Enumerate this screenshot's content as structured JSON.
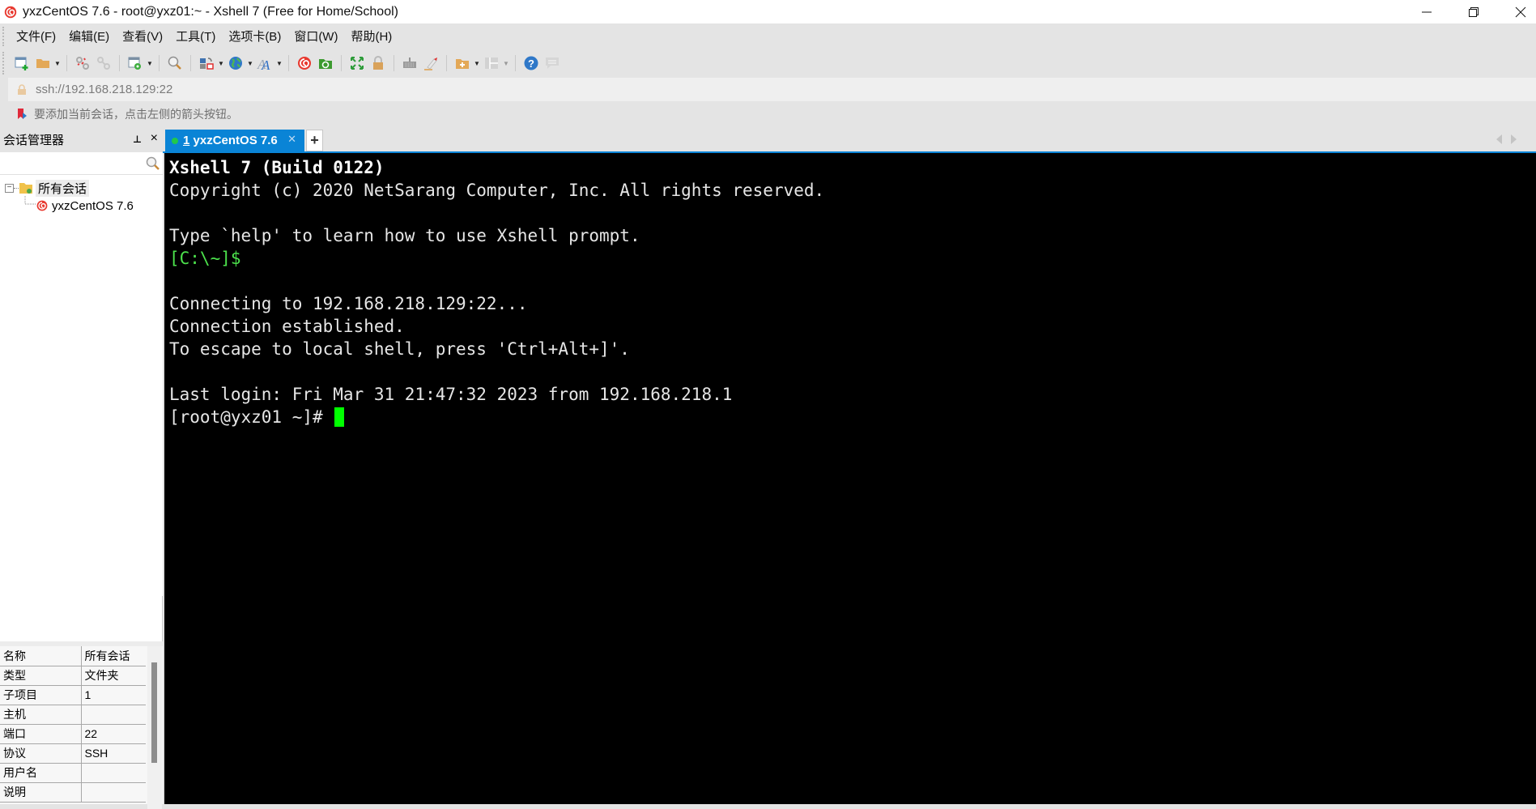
{
  "window": {
    "title": "yxzCentOS 7.6 - root@yxz01:~ - Xshell 7 (Free for Home/School)",
    "controls": {
      "minimize": "minimize",
      "restore": "restore",
      "close": "close"
    }
  },
  "menu": {
    "items": [
      {
        "label": "文件(F)"
      },
      {
        "label": "编辑(E)"
      },
      {
        "label": "查看(V)"
      },
      {
        "label": "工具(T)"
      },
      {
        "label": "选项卡(B)"
      },
      {
        "label": "窗口(W)"
      },
      {
        "label": "帮助(H)"
      }
    ]
  },
  "toolbar": {
    "icons": [
      "new-session-icon",
      "open-folder-icon",
      "disconnect-icon",
      "reconnect-icon",
      "session-properties-icon",
      "find-icon",
      "transfer-icon",
      "globe-icon",
      "font-icon",
      "xshell-icon",
      "xftp-icon",
      "fullscreen-icon",
      "lock-icon",
      "keyboard-icon",
      "highlight-icon",
      "new-folder-icon",
      "layout-icon",
      "help-icon",
      "chat-icon"
    ]
  },
  "address_bar": {
    "value": "ssh://192.168.218.129:22"
  },
  "info_bar": {
    "hint": "要添加当前会话，点击左侧的箭头按钮。"
  },
  "session_manager": {
    "title": "会话管理器",
    "search_placeholder": "",
    "tree": {
      "root": "所有会话",
      "children": [
        {
          "label": "yxzCentOS 7.6"
        }
      ]
    },
    "properties": [
      {
        "key": "名称",
        "value": "所有会话"
      },
      {
        "key": "类型",
        "value": "文件夹"
      },
      {
        "key": "子项目",
        "value": "1"
      },
      {
        "key": "主机",
        "value": ""
      },
      {
        "key": "端口",
        "value": "22"
      },
      {
        "key": "协议",
        "value": "SSH"
      },
      {
        "key": "用户名",
        "value": ""
      },
      {
        "key": "说明",
        "value": ""
      }
    ]
  },
  "tabs": [
    {
      "number": "1",
      "label": "yxzCentOS 7.6",
      "status_color": "#22c84a",
      "active": true
    }
  ],
  "colors": {
    "accent": "#0a84d6",
    "terminal_bg": "#000000",
    "terminal_fg": "#e6e6e6",
    "prompt_green": "#4ce24c",
    "cursor": "#00ff00"
  },
  "terminal": {
    "lines": [
      {
        "text": "Xshell 7 (Build 0122)",
        "style": "bold"
      },
      {
        "text": "Copyright (c) 2020 NetSarang Computer, Inc. All rights reserved.",
        "style": "normal"
      },
      {
        "text": "",
        "style": "normal"
      },
      {
        "text": "Type `help' to learn how to use Xshell prompt.",
        "style": "normal"
      },
      {
        "text": "[C:\\~]$",
        "style": "green"
      },
      {
        "text": "",
        "style": "normal"
      },
      {
        "text": "Connecting to 192.168.218.129:22...",
        "style": "normal"
      },
      {
        "text": "Connection established.",
        "style": "normal"
      },
      {
        "text": "To escape to local shell, press 'Ctrl+Alt+]'.",
        "style": "normal"
      },
      {
        "text": "",
        "style": "normal"
      },
      {
        "text": "Last login: Fri Mar 31 21:47:32 2023 from 192.168.218.1",
        "style": "normal"
      }
    ],
    "prompt": "[root@yxz01 ~]# "
  }
}
